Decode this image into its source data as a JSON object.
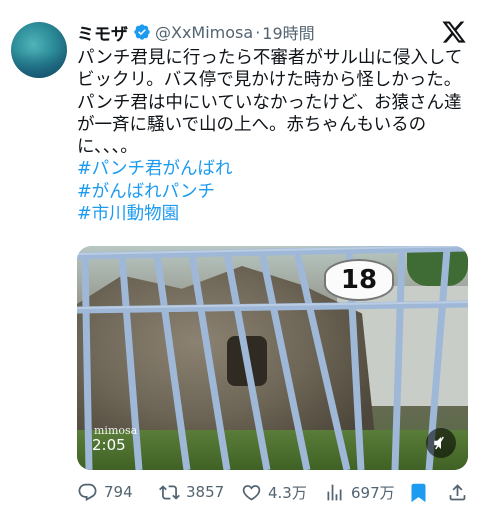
{
  "author": {
    "name": "ミモザ",
    "handle": "@XxMimosa",
    "time": "19時間"
  },
  "tweet": {
    "lines": [
      "パンチ君見に行ったら不審者がサル山に侵入して",
      "ビックリ。バス停で見かけた時から怪しかった。",
      "パンチ君は中にいていなかったけど、お猿さん達",
      "が一斉に騒いで山の上へ。赤ちゃんもいるの",
      "に、、、。"
    ],
    "hashtags": [
      "#パンチ君がんばれ",
      "#がんばれパンチ",
      "#市川動物園"
    ]
  },
  "media": {
    "sign_text": "18",
    "watermark": "mimosa",
    "duration": "2:05"
  },
  "actions": {
    "replies": "794",
    "reposts": "3857",
    "likes": "4.3万",
    "views": "697万"
  },
  "colors": {
    "accent": "#1d9bf0",
    "secondary_text": "#536471"
  },
  "icons": [
    "verified-badge-icon",
    "x-logo-icon",
    "mute-icon",
    "reply-icon",
    "repost-icon",
    "like-icon",
    "views-icon",
    "bookmark-icon",
    "share-icon"
  ]
}
